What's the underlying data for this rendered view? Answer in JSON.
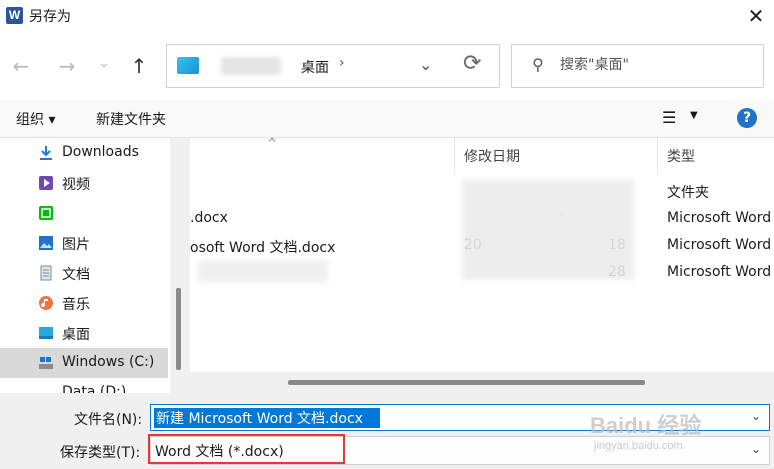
{
  "window": {
    "title": "另存为",
    "close_glyph": "✕"
  },
  "nav": {
    "back_glyph": "←",
    "forward_glyph": "→",
    "recent_glyph": "⌄",
    "up_glyph": "↑",
    "address": {
      "folder": "桌面",
      "separator": "›",
      "dropdown_glyph": "⌄",
      "refresh_glyph": "⟳"
    },
    "search": {
      "placeholder": "搜索\"桌面\"",
      "icon": "search-icon"
    }
  },
  "toolbar": {
    "organize_label": "组织 ▾",
    "new_folder_label": "新建文件夹",
    "view_glyph": "☰",
    "view_dropdown": "▼",
    "help_glyph": "?"
  },
  "sidebar": {
    "items": [
      {
        "label": "Downloads",
        "icon": "download-icon"
      },
      {
        "label": "视频",
        "icon": "video-icon"
      },
      {
        "label": "",
        "icon": "iqiyi-icon"
      },
      {
        "label": "图片",
        "icon": "picture-icon"
      },
      {
        "label": "文档",
        "icon": "document-icon"
      },
      {
        "label": "音乐",
        "icon": "music-icon"
      },
      {
        "label": "桌面",
        "icon": "desktop-icon"
      },
      {
        "label": "Windows (C:)",
        "icon": "drive-icon",
        "selected": true
      },
      {
        "label": "Data (D:)",
        "icon": "drive-icon"
      }
    ]
  },
  "filelist": {
    "columns": {
      "date": "修改日期",
      "type": "类型"
    },
    "sort_glyph": "^",
    "rows": [
      {
        "name": "",
        "date": "",
        "type": "文件夹"
      },
      {
        "name": ".docx",
        "date": "-",
        "type": "Microsoft Word"
      },
      {
        "name": "osoft Word 文档.docx",
        "date_left": "20",
        "date_right": "18",
        "type": "Microsoft Word"
      },
      {
        "name": "",
        "date_right": "28",
        "type": "Microsoft Word"
      }
    ]
  },
  "form": {
    "filename_label": "文件名(N):",
    "filename_value": "新建 Microsoft Word 文档.docx",
    "filetype_label": "保存类型(T):",
    "filetype_value": "Word 文档 (*.docx)",
    "dropdown_glyph": "⌄"
  },
  "watermark": {
    "brand": "Baidu 经验",
    "url": "jingyan.baidu.com"
  },
  "colors": {
    "accent": "#0078d7",
    "highlight": "#e23a3a",
    "selected_nav": "#d9d9d9"
  }
}
